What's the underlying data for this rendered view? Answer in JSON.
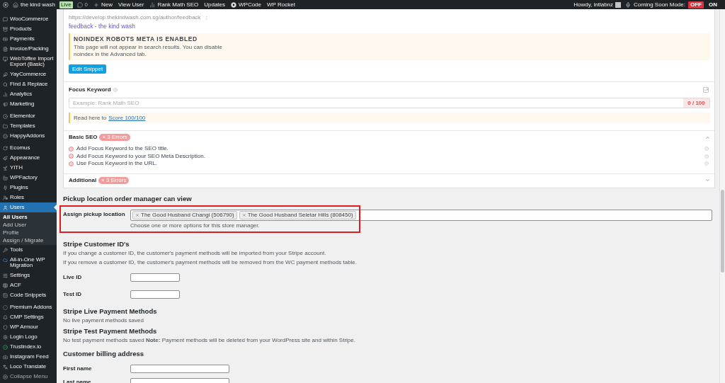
{
  "admin_bar": {
    "site": "the kind wash",
    "site_badge": "Live",
    "comments": "0",
    "items": [
      "New",
      "View User",
      "Rank Math SEO",
      "Updates",
      "WPCode",
      "WP Rocket"
    ],
    "greeting": "Howdy, intlabnz",
    "coming_soon": {
      "label": "Coming Soon Mode:",
      "options": [
        {
          "label": "OFF",
          "selected": true
        },
        {
          "label": "ON",
          "selected": false
        }
      ]
    }
  },
  "sidebar": {
    "groups": [
      {
        "items": [
          {
            "label": "WooCommerce",
            "selected": false
          },
          {
            "label": "Products",
            "selected": false
          },
          {
            "label": "Payments",
            "selected": false
          },
          {
            "label": "Invoice/Packing",
            "selected": false
          },
          {
            "label": "WebToffee Import Export (Basic)",
            "selected": false
          },
          {
            "label": "YayCommerce",
            "selected": false
          },
          {
            "label": "Find & Replace",
            "selected": false
          },
          {
            "label": "Analytics",
            "selected": false
          },
          {
            "label": "Marketing",
            "selected": false
          }
        ]
      },
      {
        "items": [
          {
            "label": "Elementor",
            "selected": false
          },
          {
            "label": "Templates",
            "selected": false
          },
          {
            "label": "HappyAddons",
            "selected": false
          }
        ]
      },
      {
        "items": [
          {
            "label": "Ecomus",
            "selected": false
          },
          {
            "label": "Appearance",
            "selected": false
          },
          {
            "label": "YITH",
            "selected": false
          },
          {
            "label": "WPFactory",
            "selected": false
          },
          {
            "label": "Plugins",
            "selected": false
          },
          {
            "label": "Roles",
            "selected": false
          },
          {
            "label": "Users",
            "selected": true,
            "children": [
              {
                "label": "All Users",
                "selected": true
              },
              {
                "label": "Add User",
                "selected": false
              },
              {
                "label": "Profile",
                "selected": false
              },
              {
                "label": "Assign / Migrate",
                "selected": false
              }
            ]
          },
          {
            "label": "Tools",
            "selected": false
          },
          {
            "label": "All-in-One WP Migration",
            "selected": false
          },
          {
            "label": "Settings",
            "selected": false
          },
          {
            "label": "ACF",
            "selected": false
          },
          {
            "label": "Code Snippets",
            "selected": false
          }
        ]
      },
      {
        "items": [
          {
            "label": "Premium Addons",
            "selected": false
          },
          {
            "label": "CMP Settings",
            "selected": false
          },
          {
            "label": "WP Armour",
            "selected": false
          },
          {
            "label": "Login Logo",
            "selected": false
          },
          {
            "label": "Trustindex.io",
            "selected": false
          },
          {
            "label": "Instagram Feed",
            "selected": false
          },
          {
            "label": "Loco Translate",
            "selected": false
          }
        ]
      }
    ],
    "collapse": "Collapse Menu"
  },
  "seo_box": {
    "preview": {
      "url": "https://develop.thekindwash.com.sg/author/feedback",
      "title": "feedback - the kind wash"
    },
    "notice": {
      "title": "NOINDEX ROBOTS META IS ENABLED",
      "text": "This page will not appear in search results. You can disable noindex in the Advanced tab."
    },
    "edit_button": "Edit Snippet",
    "focus_keyword": {
      "label": "Focus Keyword",
      "placeholder": "Example: Rank Math SEO",
      "score": "0 / 100",
      "hint": "Read here to",
      "hint_link": "Score 100/100"
    },
    "groups": [
      {
        "title": "Basic SEO",
        "badge": "× 3 Errors",
        "expanded": true,
        "tests": [
          {
            "text": "Add Focus Keyword to the SEO title.",
            "passed": false
          },
          {
            "text": "Add Focus Keyword to your SEO Meta Description.",
            "passed": false
          },
          {
            "text": "Use Focus Keyword in the URL.",
            "passed": false
          }
        ]
      },
      {
        "title": "Additional",
        "badge": "× 3 Errors",
        "expanded": false
      }
    ]
  },
  "pickup": {
    "heading": "Pickup location order manager can view",
    "highlighted": true,
    "label": "Assign pickup location",
    "tags": [
      "The Good Husband Changi (506790)",
      "The Good Husband Seletar Hills (808450)"
    ],
    "help": "Choose one or more options for this store manager."
  },
  "stripe_ids": {
    "heading": "Stripe Customer ID's",
    "notes": [
      "If you change a customer ID, the customer's payment methods will be imported from your Stripe account.",
      "If you remove a customer ID, the customer's payment methods will be removed from the WC payment methods table."
    ],
    "fields": [
      {
        "label": "Live ID"
      },
      {
        "label": "Test ID"
      }
    ]
  },
  "stripe_live": {
    "heading": "Stripe Live Payment Methods",
    "text": "No live payment methods saved"
  },
  "stripe_test": {
    "heading": "Stripe Test Payment Methods",
    "text": "No test payment methods saved **Note:** Payment methods will be deleted from your WordPress site and within Stripe."
  },
  "billing": {
    "heading": "Customer billing address",
    "fields": [
      {
        "label": "First name"
      },
      {
        "label": "Last name"
      }
    ]
  }
}
